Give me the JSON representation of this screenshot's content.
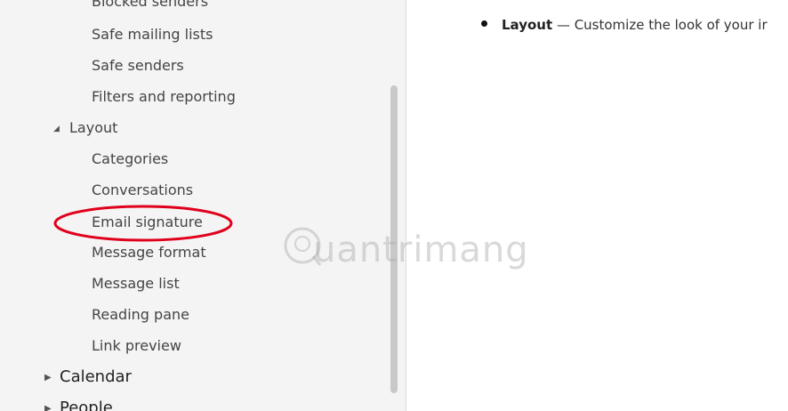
{
  "sidebar": {
    "clipped_top_item": "Blocked senders",
    "junk_items": [
      "Safe mailing lists",
      "Safe senders",
      "Filters and reporting"
    ],
    "layout_group": "Layout",
    "layout_items": [
      "Categories",
      "Conversations",
      "Email signature",
      "Message format",
      "Message list",
      "Reading pane",
      "Link preview"
    ],
    "top_sections": [
      "Calendar",
      "People"
    ]
  },
  "content": {
    "bullet_term": "Layout",
    "bullet_text": "— Customize the look of your ir"
  },
  "watermark": {
    "text": "uantrimang"
  },
  "colors": {
    "highlight_ring": "#e0001b",
    "sidebar_bg": "#f4f4f4"
  },
  "icons": {
    "group_expanded": "triangle-expanded-icon",
    "section_collapsed": "triangle-collapsed-icon"
  }
}
